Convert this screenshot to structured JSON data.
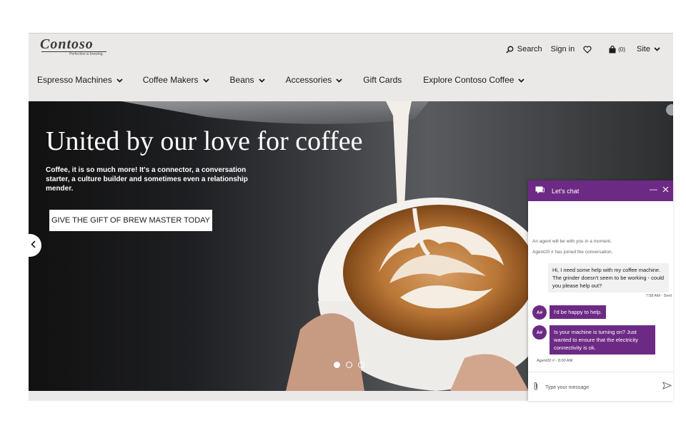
{
  "brand": {
    "name": "Contoso",
    "tagline": "Perfection is brewing."
  },
  "utility": {
    "search_label": "Search",
    "signin_label": "Sign in",
    "cart_count": "(0)",
    "site_label": "Site",
    "icons": [
      "search-icon",
      "heart-icon",
      "shopping-bag-icon",
      "chevron-down-icon"
    ]
  },
  "nav": {
    "items": [
      {
        "label": "Espresso Machines",
        "dropdown": true
      },
      {
        "label": "Coffee Makers",
        "dropdown": true
      },
      {
        "label": "Beans",
        "dropdown": true
      },
      {
        "label": "Accessories",
        "dropdown": true
      },
      {
        "label": "Gift Cards",
        "dropdown": false
      },
      {
        "label": "Explore Contoso Coffee",
        "dropdown": true
      }
    ]
  },
  "hero": {
    "title": "United by our love for coffee",
    "subtitle": "Coffee, it is so much more! It's a connector, a conversation starter, a culture builder and sometimes even a relationship mender.",
    "cta_label": "GIVE THE GIFT OF BREW MASTER TODAY",
    "slides_total": 3,
    "active_slide": 1
  },
  "chat": {
    "title": "Let's chat",
    "accent": "#6d2a84",
    "system_messages": [
      "An agent will be with you in a moment.",
      "Agent20 # has joined the conversation."
    ],
    "user_message": "Hi, I need some help with my coffee machine. The grinder doesn't seem to be working - could you please help out?",
    "user_meta": "7:58 AM - Sent",
    "agent_initials": "A#",
    "agent_messages": [
      "I'd be happy to help.",
      "Is your machine is turning on? Just wanted to ensure that the electricity connectivity is ok."
    ],
    "agent_meta": "Agent20 # - 8:00 AM",
    "input_placeholder": "Type your message"
  }
}
